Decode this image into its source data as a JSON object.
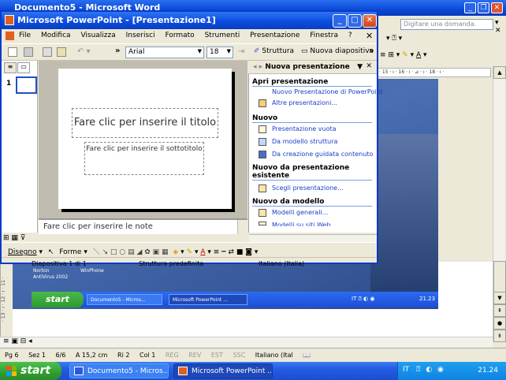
{
  "word": {
    "title": "Documento5 - Microsoft Word",
    "help_placeholder": "Digitare una domanda.",
    "ruler_text": "· 15 · ı · 16 · ı · ⊿ · ı · 18 · ı ·",
    "left_ruler_text": "· 13 · ı · 12 · ı · 11 ·",
    "status": {
      "page": "Pg 6",
      "section": "Sez 1",
      "pages": "6/6",
      "position": "A 15,2 cm",
      "row": "Ri 2",
      "col": "Col 1",
      "rec": "REG",
      "rev": "REV",
      "ext": "EST",
      "ovr": "SSC",
      "language": "Italiano (Ital"
    }
  },
  "screenshot": {
    "icons": [
      "Norton",
      "AntiVirus 2002",
      "WinPhone"
    ],
    "start_label": "start",
    "tasks": [
      "Documento5 - Micros...",
      "Microsoft PowerPoint ..."
    ],
    "clock": "21.23"
  },
  "taskbar": {
    "start_label": "start",
    "tasks": [
      "Documento5 - Micros...",
      "Microsoft PowerPoint ..."
    ],
    "tray_lang": "IT",
    "clock": "21.24"
  },
  "ppt": {
    "title": "Microsoft PowerPoint - [Presentazione1]",
    "menu": [
      "File",
      "Modifica",
      "Visualizza",
      "Inserisci",
      "Formato",
      "Strumenti",
      "Presentazione",
      "Finestra",
      "?"
    ],
    "font": "Arial",
    "size": "18",
    "btn_struttura": "Struttura",
    "btn_nuova": "Nuova diapositiva",
    "slide_number": "1",
    "title_placeholder": "Fare clic per inserire il titolo",
    "subtitle_placeholder": "Fare clic per inserire il sottotitolo",
    "notes_placeholder": "Fare clic per inserire le note",
    "draw_label": "Disegno",
    "forme_label": "Forme",
    "status": {
      "slide": "Diapositiva 1 di 1",
      "design": "Struttura predefinita",
      "language": "Italiano (Italia)"
    }
  },
  "taskpane": {
    "title": "Nuova presentazione",
    "sections": [
      {
        "heading": "Apri presentazione",
        "links": [
          "Nuovo Presentazione di PowerPoint",
          "Altre presentazioni..."
        ]
      },
      {
        "heading": "Nuovo",
        "links": [
          "Presentazione vuota",
          "Da modello struttura",
          "Da creazione guidata contenuto"
        ]
      },
      {
        "heading": "Nuovo da presentazione esistente",
        "links": [
          "Scegli presentazione..."
        ]
      },
      {
        "heading": "Nuovo da modello",
        "links": [
          "Modelli generali...",
          "Modelli su siti Web..."
        ]
      }
    ]
  }
}
